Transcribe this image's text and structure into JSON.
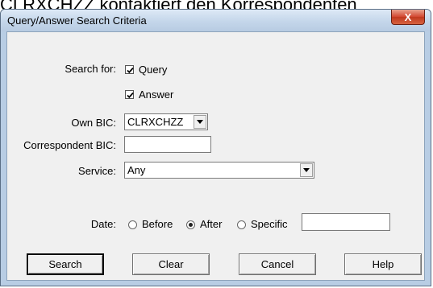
{
  "background": {
    "caption": "CLRXCHZZ kontaktiert den Korrespondenten"
  },
  "window": {
    "title": "Query/Answer Search Criteria",
    "close_glyph": "X"
  },
  "form": {
    "search_for_label": "Search for:",
    "query_label": "Query",
    "query_checked": true,
    "answer_label": "Answer",
    "answer_checked": true,
    "own_bic_label": "Own BIC:",
    "own_bic_value": "CLRXCHZZ",
    "correspondent_bic_label": "Correspondent BIC:",
    "correspondent_bic_value": "",
    "service_label": "Service:",
    "service_value": "Any",
    "date_label": "Date:",
    "date_options": [
      "Before",
      "After",
      "Specific"
    ],
    "date_selected": "After",
    "date_value": ""
  },
  "buttons": {
    "search": "Search",
    "clear": "Clear",
    "cancel": "Cancel",
    "help": "Help"
  },
  "icons": {
    "checkmark": "check-icon",
    "dropdown": "chevron-down-icon",
    "close": "close-icon"
  }
}
